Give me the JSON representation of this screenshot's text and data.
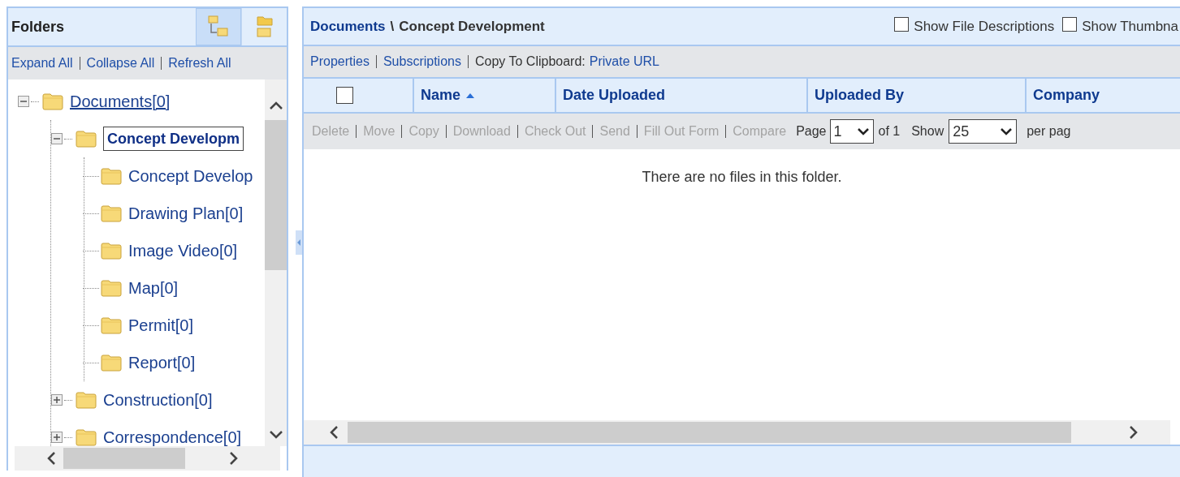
{
  "folders_panel": {
    "title": "Folders",
    "view_buttons": [
      {
        "kind": "tree",
        "selected": true
      },
      {
        "kind": "list",
        "selected": false
      }
    ],
    "links": [
      "Expand All",
      "Collapse All",
      "Refresh All"
    ]
  },
  "tree": {
    "items": [
      {
        "label": "Documents[0]",
        "expanded": true,
        "selected": false,
        "underlined": true,
        "children": [
          {
            "label": "Concept Developm",
            "expanded": true,
            "selected": true,
            "underlined": false,
            "children": [
              {
                "label": "Concept Develop",
                "selected": false,
                "underlined": false
              },
              {
                "label": "Drawing Plan[0]",
                "selected": false,
                "underlined": false
              },
              {
                "label": "Image Video[0]",
                "selected": false,
                "underlined": false
              },
              {
                "label": "Map[0]",
                "selected": false,
                "underlined": false
              },
              {
                "label": "Permit[0]",
                "selected": false,
                "underlined": false
              },
              {
                "label": "Report[0]",
                "selected": false,
                "underlined": false
              }
            ]
          },
          {
            "label": "Construction[0]",
            "expanded": false,
            "selected": false,
            "underlined": false
          },
          {
            "label": "Correspondence[0]",
            "expanded": false,
            "selected": false,
            "underlined": false
          }
        ]
      }
    ]
  },
  "breadcrumb": {
    "root": "Documents",
    "separator": "\\",
    "current": "Concept Development"
  },
  "options": [
    {
      "label": "Show File Descriptions",
      "checked": false
    },
    {
      "label": "Show Thumbna",
      "checked": false
    }
  ],
  "folder_links": [
    {
      "label": "Properties",
      "kind": "link"
    },
    {
      "label": "Subscriptions",
      "kind": "link"
    },
    {
      "label": "Copy To Clipboard:",
      "kind": "text"
    },
    {
      "label": "Private URL",
      "kind": "link"
    }
  ],
  "table": {
    "select_all": {
      "checked": false
    },
    "columns": [
      {
        "label": "Name",
        "sorted": true
      },
      {
        "label": "Date Uploaded",
        "sorted": false
      },
      {
        "label": "Uploaded By",
        "sorted": false
      },
      {
        "label": "Company",
        "sorted": false
      }
    ],
    "actions": [
      {
        "label": "Delete",
        "disabled": true
      },
      {
        "label": "Move",
        "disabled": true
      },
      {
        "label": "Copy",
        "disabled": true
      },
      {
        "label": "Download",
        "disabled": true
      },
      {
        "label": "Check Out",
        "disabled": true
      },
      {
        "label": "Send",
        "disabled": true
      },
      {
        "label": "Fill Out Form",
        "disabled": true
      },
      {
        "label": "Compare",
        "disabled": true
      }
    ],
    "pager": {
      "page_label": "Page",
      "page": "1",
      "of_label": "of 1",
      "show_label": "Show",
      "page_size": "25",
      "per_page_label": "per pag"
    },
    "empty_message": "There are no files in this folder."
  }
}
